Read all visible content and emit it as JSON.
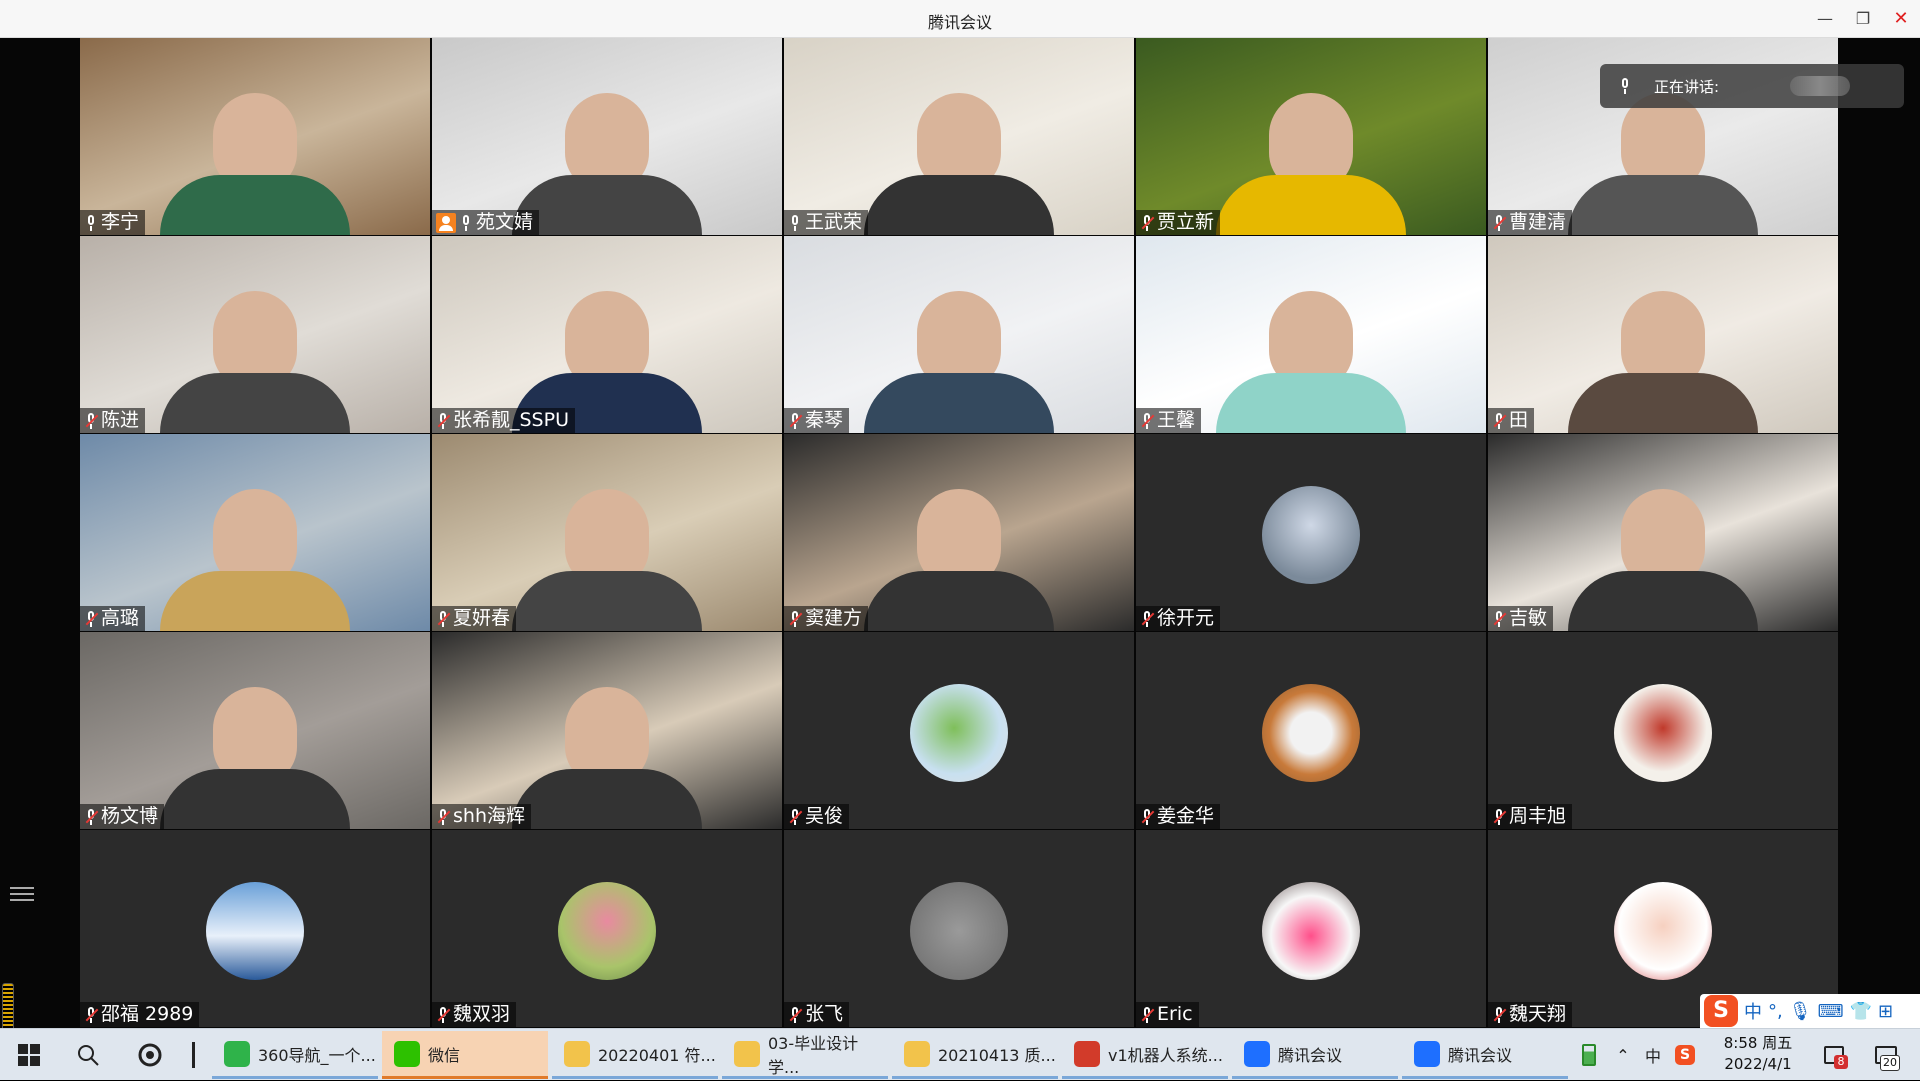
{
  "window": {
    "title": "腾讯会议",
    "minimize": "—",
    "restore": "❐",
    "close": "✕"
  },
  "speaking_indicator": {
    "label": "正在讲话:"
  },
  "participants": [
    {
      "name": "李宁",
      "mic": "on",
      "kind": "video"
    },
    {
      "name": "苑文婧",
      "mic": "on",
      "kind": "video",
      "host": true
    },
    {
      "name": "王武荣",
      "mic": "on",
      "kind": "video"
    },
    {
      "name": "贾立新",
      "mic": "muted",
      "kind": "video"
    },
    {
      "name": "曹建清",
      "mic": "muted",
      "kind": "video"
    },
    {
      "name": "陈进",
      "mic": "muted",
      "kind": "video"
    },
    {
      "name": "张希靓_SSPU",
      "mic": "muted",
      "kind": "video"
    },
    {
      "name": "秦琴",
      "mic": "muted",
      "kind": "video"
    },
    {
      "name": "王馨",
      "mic": "muted",
      "kind": "video"
    },
    {
      "name": "田",
      "mic": "muted",
      "kind": "video"
    },
    {
      "name": "高璐",
      "mic": "muted",
      "kind": "video"
    },
    {
      "name": "夏妍春",
      "mic": "muted",
      "kind": "video"
    },
    {
      "name": "窦建方",
      "mic": "muted",
      "kind": "video"
    },
    {
      "name": "徐开元",
      "mic": "muted",
      "kind": "avatar"
    },
    {
      "name": "吉敏",
      "mic": "muted",
      "kind": "video"
    },
    {
      "name": "杨文博",
      "mic": "muted",
      "kind": "video"
    },
    {
      "name": "shh海辉",
      "mic": "muted",
      "kind": "video"
    },
    {
      "name": "吴俊",
      "mic": "muted",
      "kind": "avatar"
    },
    {
      "name": "姜金华",
      "mic": "muted",
      "kind": "avatar"
    },
    {
      "name": "周丰旭",
      "mic": "muted",
      "kind": "avatar"
    },
    {
      "name": "邵福 2989",
      "mic": "muted",
      "kind": "avatar"
    },
    {
      "name": "魏双羽",
      "mic": "muted",
      "kind": "avatar"
    },
    {
      "name": "张飞",
      "mic": "muted",
      "kind": "avatar"
    },
    {
      "name": "Eric",
      "mic": "muted",
      "kind": "avatar"
    },
    {
      "name": "魏天翔",
      "mic": "muted",
      "kind": "avatar"
    }
  ],
  "ime": {
    "mode": "中",
    "punct": "°,",
    "icons": [
      "microphone-icon",
      "keyboard-icon",
      "shirt-icon",
      "grid-icon"
    ]
  },
  "taskbar": {
    "apps": [
      {
        "label": "360导航_一个...",
        "icon_color": "#2fb34a",
        "state": "open"
      },
      {
        "label": "微信",
        "icon_color": "#2dc100",
        "state": "active"
      },
      {
        "label": "20220401 符...",
        "icon_color": "#f2c34b",
        "state": "open"
      },
      {
        "label": "03-毕业设计学...",
        "icon_color": "#f2c34b",
        "state": "open"
      },
      {
        "label": "20210413 质...",
        "icon_color": "#f2c34b",
        "state": "open"
      },
      {
        "label": "v1机器人系统...",
        "icon_color": "#d23b2a",
        "state": "open"
      },
      {
        "label": "腾讯会议",
        "icon_color": "#1e6fff",
        "state": "open"
      },
      {
        "label": "腾讯会议",
        "icon_color": "#1e6fff",
        "state": "open"
      }
    ],
    "tray_lang": "中",
    "time": "8:58 周五",
    "date": "2022/4/1",
    "msg_badge": "8",
    "notify_badge": "20"
  }
}
